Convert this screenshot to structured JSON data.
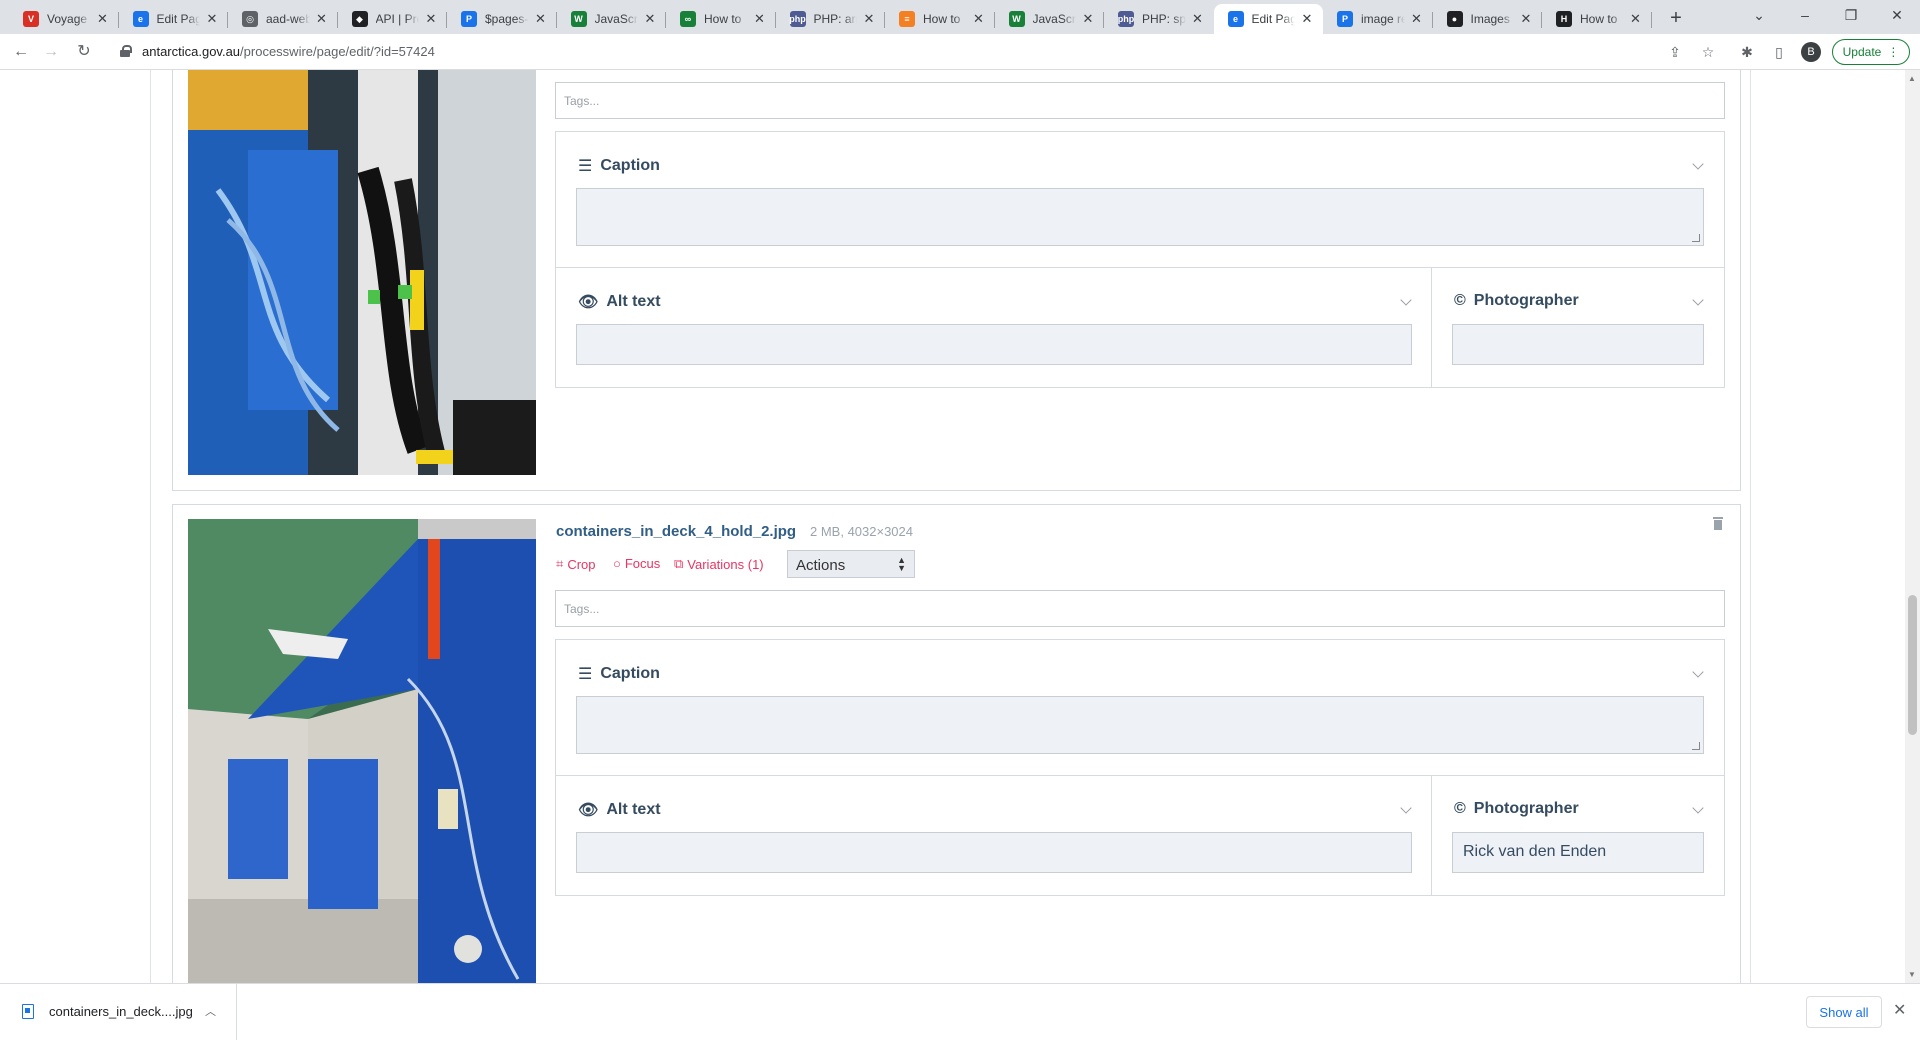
{
  "browser": {
    "tabs": [
      {
        "title": "Voyage",
        "favicon_color": "#d93025",
        "favicon_glyph": "V"
      },
      {
        "title": "Edit Page",
        "favicon_color": "#1a73e8",
        "favicon_glyph": "e"
      },
      {
        "title": "aad-web",
        "favicon_color": "#5f6368",
        "favicon_glyph": "◎"
      },
      {
        "title": "API | Pre",
        "favicon_color": "#202124",
        "favicon_glyph": "◆"
      },
      {
        "title": "$pages-",
        "favicon_color": "#1a73e8",
        "favicon_glyph": "P"
      },
      {
        "title": "JavaScri",
        "favicon_color": "#188038",
        "favicon_glyph": "W"
      },
      {
        "title": "How to",
        "favicon_color": "#188038",
        "favicon_glyph": "∞"
      },
      {
        "title": "PHP: arr",
        "favicon_color": "#4f5b93",
        "favicon_glyph": "php"
      },
      {
        "title": "How to",
        "favicon_color": "#f48024",
        "favicon_glyph": "≡"
      },
      {
        "title": "JavaScri",
        "favicon_color": "#188038",
        "favicon_glyph": "W"
      },
      {
        "title": "PHP: spl",
        "favicon_color": "#4f5b93",
        "favicon_glyph": "php"
      },
      {
        "title": "Edit Pag",
        "favicon_color": "#1a73e8",
        "favicon_glyph": "e"
      },
      {
        "title": "image re",
        "favicon_color": "#1a73e8",
        "favicon_glyph": "P"
      },
      {
        "title": "Images",
        "favicon_color": "#202124",
        "favicon_glyph": "●"
      },
      {
        "title": "How to",
        "favicon_color": "#202124",
        "favicon_glyph": "H"
      }
    ],
    "active_tab_index": 11,
    "url_domain": "antarctica.gov.au",
    "url_path": "/processwire/page/edit/?id=57424",
    "profile_initial": "B",
    "update_label": "Update"
  },
  "images": [
    {
      "filename": "",
      "meta": "",
      "tags_placeholder": "Tags...",
      "caption_label": "Caption",
      "alt_label": "Alt text",
      "photographer_label": "Photographer",
      "photographer_value": ""
    },
    {
      "filename": "containers_in_deck_4_hold_2.jpg",
      "meta": "2 MB, 4032×3024",
      "crop_label": "Crop",
      "focus_label": "Focus",
      "variations_label": "Variations (1)",
      "actions_label": "Actions",
      "tags_placeholder": "Tags...",
      "caption_label": "Caption",
      "alt_label": "Alt text",
      "photographer_label": "Photographer",
      "photographer_value": "Rick van den Enden"
    }
  ],
  "downloads": {
    "item_name": "containers_in_deck....jpg",
    "show_all_label": "Show all"
  },
  "colors": {
    "accent_link": "#e83561",
    "filename": "#315e85",
    "field_bg": "#eef1f6"
  }
}
